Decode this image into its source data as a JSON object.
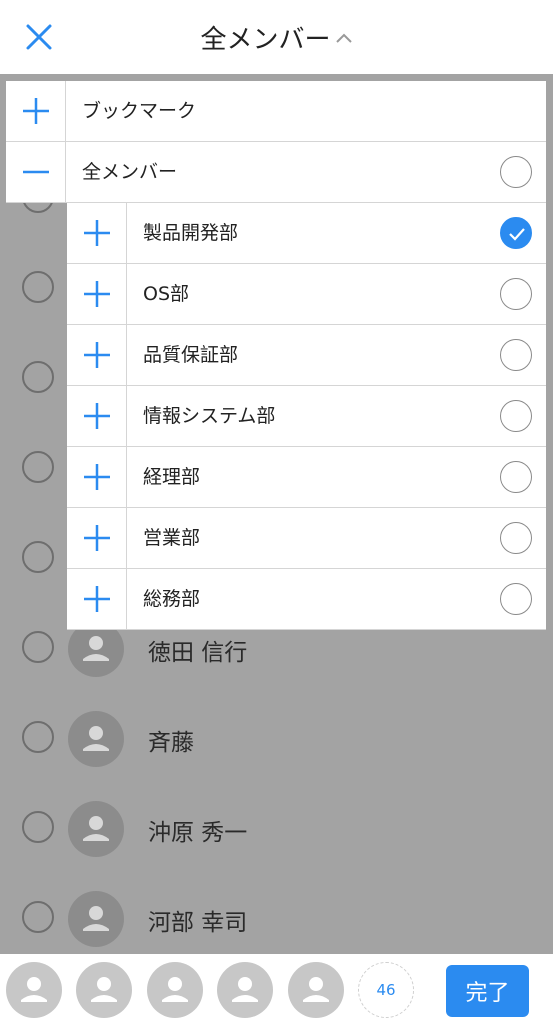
{
  "header": {
    "title": "全メンバー",
    "close_icon": "close-icon",
    "chevron_icon": "chevron-up-icon",
    "accent_color": "#2b8bf0"
  },
  "members": [
    {
      "name": "徳田 信行",
      "selected": false
    },
    {
      "name": "斉藤",
      "selected": false
    },
    {
      "name": "沖原 秀一",
      "selected": false
    },
    {
      "name": "河部 幸司",
      "selected": false
    }
  ],
  "groups": [
    {
      "label": "ブックマーク",
      "expand_icon": "plus-icon",
      "has_radio": false,
      "checked": false
    },
    {
      "label": "全メンバー",
      "expand_icon": "minus-icon",
      "has_radio": true,
      "checked": false
    },
    {
      "label": "製品開発部",
      "expand_icon": "plus-icon",
      "has_radio": true,
      "checked": true
    },
    {
      "label": "OS部",
      "expand_icon": "plus-icon",
      "has_radio": true,
      "checked": false
    },
    {
      "label": "品質保証部",
      "expand_icon": "plus-icon",
      "has_radio": true,
      "checked": false
    },
    {
      "label": "情報システム部",
      "expand_icon": "plus-icon",
      "has_radio": true,
      "checked": false
    },
    {
      "label": "経理部",
      "expand_icon": "plus-icon",
      "has_radio": true,
      "checked": false
    },
    {
      "label": "営業部",
      "expand_icon": "plus-icon",
      "has_radio": true,
      "checked": false
    },
    {
      "label": "総務部",
      "expand_icon": "plus-icon",
      "has_radio": true,
      "checked": false
    }
  ],
  "bottom_bar": {
    "selected_count": "46",
    "done_label": "完了"
  }
}
